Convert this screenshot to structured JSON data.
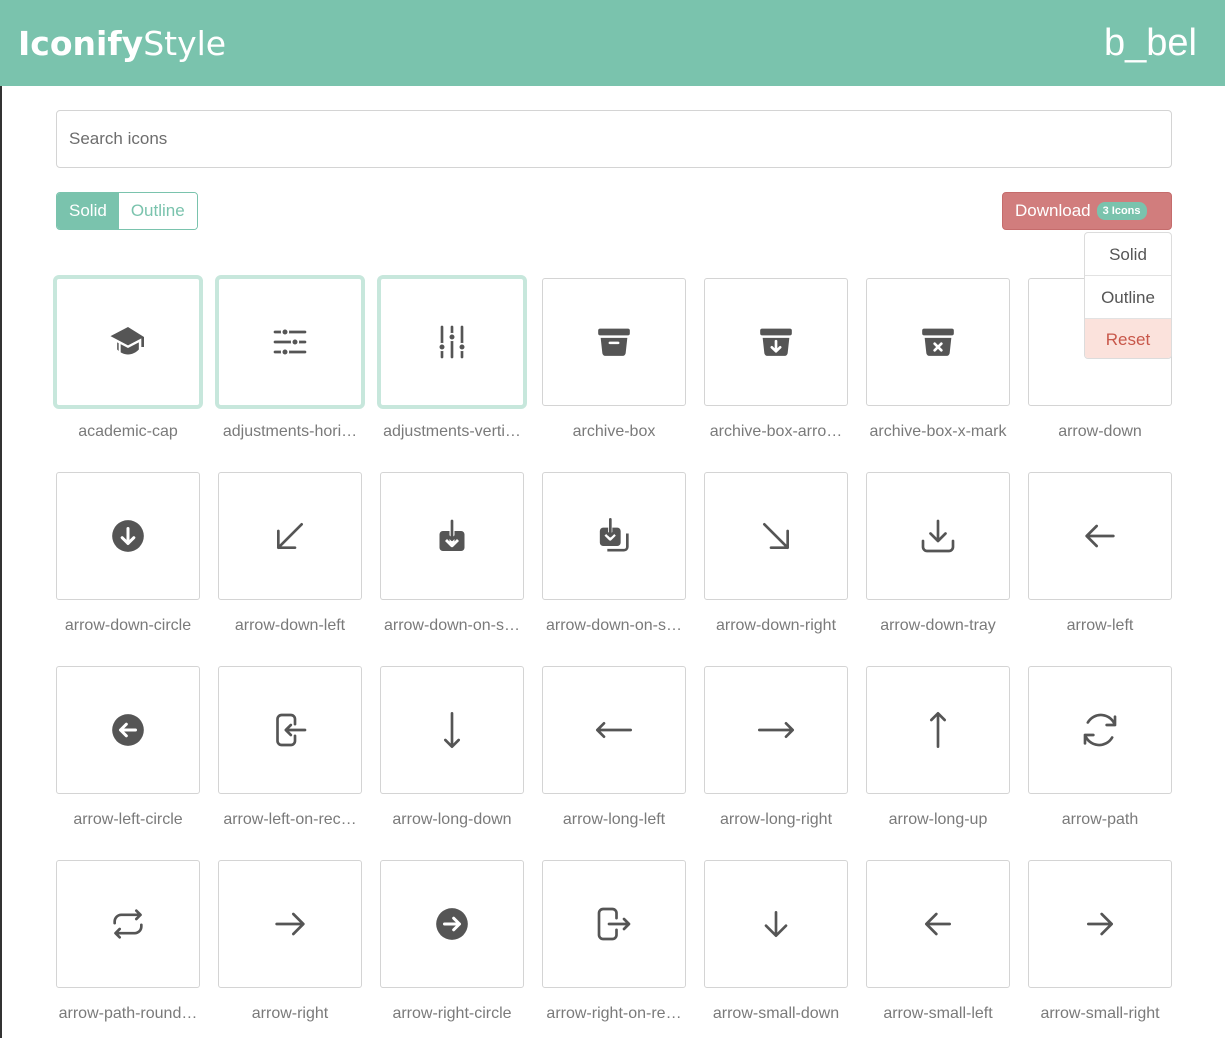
{
  "header": {
    "logo_bold": "Iconify",
    "logo_light": "Style",
    "username": "b_bel"
  },
  "search": {
    "placeholder": "Search icons"
  },
  "style_toggle": {
    "solid_label": "Solid",
    "outline_label": "Outline",
    "active": "Solid"
  },
  "download": {
    "label": "Download",
    "badge": "3 Icons"
  },
  "download_menu": [
    {
      "label": "Solid"
    },
    {
      "label": "Outline"
    },
    {
      "label": "Reset"
    }
  ],
  "colors": {
    "accent": "#7ac3ad",
    "download": "#d17d7d",
    "icon": "#555555",
    "selected_border": "#c7e7dc",
    "reset_bg": "#fbe2dc"
  },
  "icons": [
    {
      "name": "academic-cap",
      "label": "academic-cap",
      "selected": true
    },
    {
      "name": "adjustments-horizontal",
      "label": "adjustments-hori…",
      "selected": true
    },
    {
      "name": "adjustments-vertical",
      "label": "adjustments-verti…",
      "selected": true
    },
    {
      "name": "archive-box",
      "label": "archive-box",
      "selected": false
    },
    {
      "name": "archive-box-arrow-down",
      "label": "archive-box-arro…",
      "selected": false
    },
    {
      "name": "archive-box-x-mark",
      "label": "archive-box-x-mark",
      "selected": false
    },
    {
      "name": "arrow-down",
      "label": "arrow-down",
      "selected": false
    },
    {
      "name": "arrow-down-circle",
      "label": "arrow-down-circle",
      "selected": false
    },
    {
      "name": "arrow-down-left",
      "label": "arrow-down-left",
      "selected": false
    },
    {
      "name": "arrow-down-on-square",
      "label": "arrow-down-on-s…",
      "selected": false
    },
    {
      "name": "arrow-down-on-square-stack",
      "label": "arrow-down-on-s…",
      "selected": false
    },
    {
      "name": "arrow-down-right",
      "label": "arrow-down-right",
      "selected": false
    },
    {
      "name": "arrow-down-tray",
      "label": "arrow-down-tray",
      "selected": false
    },
    {
      "name": "arrow-left",
      "label": "arrow-left",
      "selected": false
    },
    {
      "name": "arrow-left-circle",
      "label": "arrow-left-circle",
      "selected": false
    },
    {
      "name": "arrow-left-on-rectangle",
      "label": "arrow-left-on-rec…",
      "selected": false
    },
    {
      "name": "arrow-long-down",
      "label": "arrow-long-down",
      "selected": false
    },
    {
      "name": "arrow-long-left",
      "label": "arrow-long-left",
      "selected": false
    },
    {
      "name": "arrow-long-right",
      "label": "arrow-long-right",
      "selected": false
    },
    {
      "name": "arrow-long-up",
      "label": "arrow-long-up",
      "selected": false
    },
    {
      "name": "arrow-path",
      "label": "arrow-path",
      "selected": false
    },
    {
      "name": "arrow-path-rounded-square",
      "label": "arrow-path-round…",
      "selected": false
    },
    {
      "name": "arrow-right",
      "label": "arrow-right",
      "selected": false
    },
    {
      "name": "arrow-right-circle",
      "label": "arrow-right-circle",
      "selected": false
    },
    {
      "name": "arrow-right-on-rectangle",
      "label": "arrow-right-on-re…",
      "selected": false
    },
    {
      "name": "arrow-small-down",
      "label": "arrow-small-down",
      "selected": false
    },
    {
      "name": "arrow-small-left",
      "label": "arrow-small-left",
      "selected": false
    },
    {
      "name": "arrow-small-right",
      "label": "arrow-small-right",
      "selected": false
    }
  ]
}
